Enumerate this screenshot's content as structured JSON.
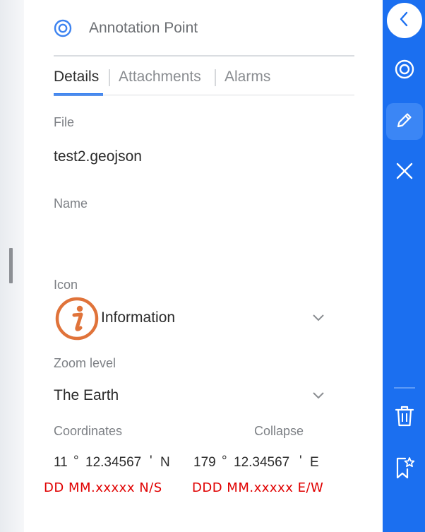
{
  "header": {
    "title": "Annotation Point"
  },
  "tabs": [
    {
      "label": "Details"
    },
    {
      "label": "Attachments"
    },
    {
      "label": "Alarms"
    }
  ],
  "file": {
    "label": "File",
    "value": "test2.geojson"
  },
  "name": {
    "label": "Name",
    "value": ""
  },
  "icon": {
    "label": "Icon",
    "value": "Information"
  },
  "zoom": {
    "label": "Zoom level",
    "value": "The Earth"
  },
  "coordinates": {
    "label": "Coordinates",
    "collapse_label": "Collapse",
    "lat": {
      "deg": "11",
      "deg_symbol": "°",
      "min": "12.34567",
      "min_symbol": "'",
      "hemi": "N"
    },
    "lon": {
      "deg": "179",
      "deg_symbol": "°",
      "min": "12.34567",
      "min_symbol": "'",
      "hemi": "E"
    },
    "lat_note": "DD MM.xxxxx  N/S",
    "lon_note": "DDD MM.xxxxx  E/W"
  },
  "sidebar": {
    "icons": [
      "chevron-left",
      "target",
      "pencil",
      "close",
      "trash",
      "bookmark-star"
    ]
  },
  "colors": {
    "accent": "#1b6ff0",
    "info_icon": "#e0733a",
    "red_note": "#e00000"
  }
}
